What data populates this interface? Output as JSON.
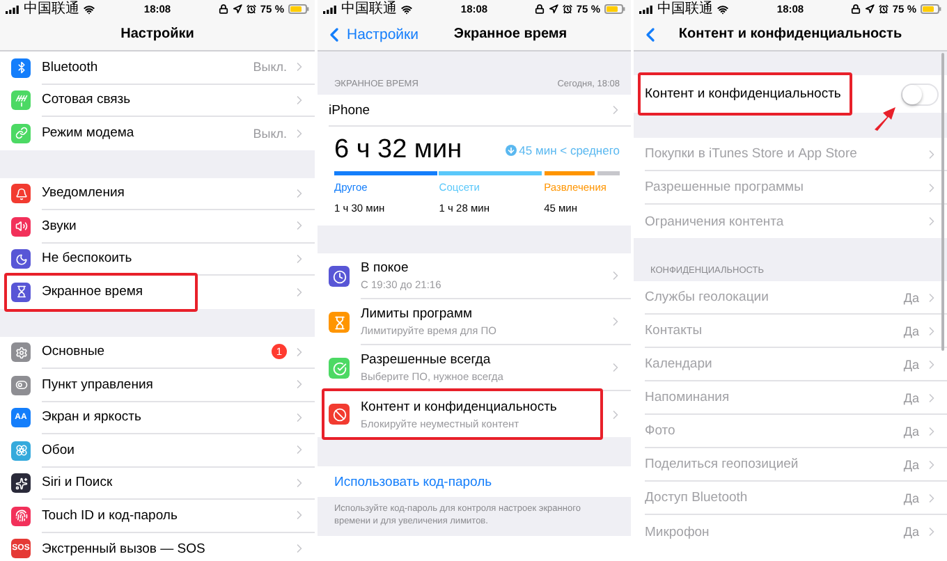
{
  "screens": [
    {
      "kind": "settings",
      "status_bar": {
        "carrier": "中国联通",
        "time": "18:08",
        "battery": "75 %"
      },
      "nav": {
        "title": "Настройки",
        "back_arrow": false
      },
      "groups": [
        {
          "rows": [
            {
              "label": "Bluetooth",
              "value": "Выкл.",
              "color": "#147efb",
              "highlighted": false
            },
            {
              "label": "Сотовая связь",
              "color": "#4cd964",
              "highlighted": false
            },
            {
              "label": "Режим модема",
              "value": "Выкл.",
              "color": "#4cd964",
              "highlighted": false
            }
          ]
        },
        {
          "rows": [
            {
              "label": "Уведомления",
              "color": "#f23b30",
              "highlighted": false
            },
            {
              "label": "Звуки",
              "color": "#f2305a",
              "highlighted": false
            },
            {
              "label": "Не беспокоить",
              "color": "#5856d6",
              "highlighted": false
            },
            {
              "label": "Экранное время",
              "color": "#5856d6",
              "highlighted": true
            }
          ]
        },
        {
          "rows": [
            {
              "label": "Основные",
              "badge": "1",
              "color": "#8e8e93",
              "highlighted": false
            },
            {
              "label": "Пункт управления",
              "color": "#8e8e93",
              "highlighted": false
            },
            {
              "label": "Экран и яркость",
              "icon_label": "AA",
              "color": "#147efb",
              "highlighted": false
            },
            {
              "label": "Обои",
              "color": "#35aadc",
              "highlighted": false
            },
            {
              "label": "Siri и Поиск",
              "color": "#2a2a3a",
              "highlighted": false
            },
            {
              "label": "Touch ID и код-пароль",
              "color": "#f2305a",
              "highlighted": false
            },
            {
              "label": "Экстренный вызов — SOS",
              "icon_label": "SOS",
              "color": "#e53935",
              "highlighted": false
            }
          ]
        }
      ]
    },
    {
      "kind": "screen_time",
      "status_bar": {
        "carrier": "中国联通",
        "time": "18:08",
        "battery": "75 %"
      },
      "nav": {
        "title": "Экранное время",
        "back": "Настройки",
        "back_arrow": true
      },
      "summary": {
        "header": "ЭКРАННОЕ ВРЕМЯ",
        "date": "Сегодня, 18:08",
        "device": "iPhone",
        "total": "6 ч 32 мин",
        "compare": "45 мин < среднего",
        "categories": [
          {
            "name": "Другое",
            "time": "1 ч 30 мин",
            "color": "#147efb"
          },
          {
            "name": "Соцсети",
            "time": "1 ч 28 мин",
            "color": "#5ac8fa"
          },
          {
            "name": "Развлечения",
            "time": "45 мин",
            "color": "#ff9500"
          }
        ]
      },
      "rows": [
        {
          "title": "В покое",
          "subtitle": "С 19:30 до 21:16",
          "color": "#5856d6",
          "highlighted": false
        },
        {
          "title": "Лимиты программ",
          "subtitle": "Лимитируйте время для ПО",
          "color": "#ff9500",
          "highlighted": false
        },
        {
          "title": "Разрешенные всегда",
          "subtitle": "Выберите ПО, нужное всегда",
          "color": "#4cd964",
          "highlighted": false
        },
        {
          "title": "Контент и конфиденциальность",
          "subtitle": "Блокируйте неуместный контент",
          "color": "#f23b30",
          "highlighted": true
        }
      ],
      "passcode_link": "Использовать код-пароль",
      "footer": "Используйте код-пароль для контроля настроек экранного времени и для увеличения лимитов."
    },
    {
      "kind": "restrictions",
      "status_bar": {
        "carrier": "中国联通",
        "time": "18:08",
        "battery": "75 %"
      },
      "nav": {
        "title": "Контент и конфиденциальность",
        "back_arrow": true
      },
      "toggle_row": {
        "label": "Контент и конфиденциальность",
        "on": false,
        "highlighted": true
      },
      "rows": [
        {
          "label": "Покупки в iTunes Store и App Store",
          "disabled": true
        },
        {
          "label": "Разрешенные программы",
          "disabled": true
        },
        {
          "label": "Ограничения контента",
          "disabled": true
        }
      ],
      "section_header": "КОНФИДЕНЦИАЛЬНОСТЬ",
      "privacy_rows": [
        {
          "label": "Службы геолокации",
          "value": "Да",
          "disabled": true
        },
        {
          "label": "Контакты",
          "value": "Да",
          "disabled": true
        },
        {
          "label": "Календари",
          "value": "Да",
          "disabled": true
        },
        {
          "label": "Напоминания",
          "value": "Да",
          "disabled": true
        },
        {
          "label": "Фото",
          "value": "Да",
          "disabled": true
        },
        {
          "label": "Поделиться геопозицией",
          "value": "Да",
          "disabled": true
        },
        {
          "label": "Доступ Bluetooth",
          "value": "Да",
          "disabled": true
        },
        {
          "label": "Микрофон",
          "value": "Да",
          "disabled": true
        }
      ]
    }
  ]
}
